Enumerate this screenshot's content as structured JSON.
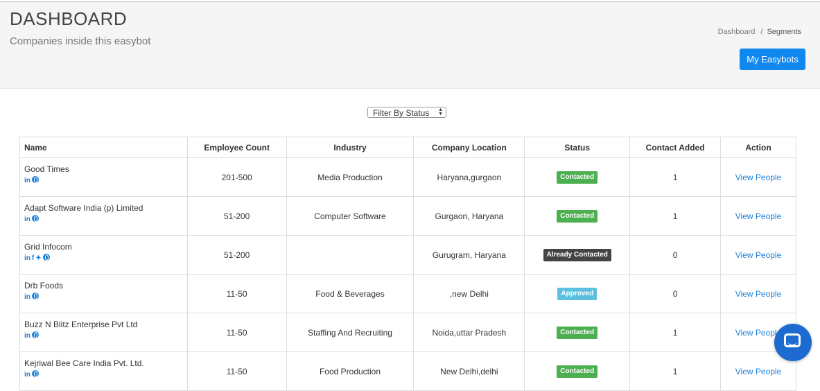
{
  "header": {
    "title": "DASHBOARD",
    "subtitle": "Companies inside this easybot",
    "breadcrumb": {
      "home": "Dashboard",
      "separator": "/",
      "current": "Segments"
    },
    "primary_button": "My Easybots"
  },
  "filter": {
    "selected": "Filter By Status"
  },
  "table": {
    "columns": [
      "Name",
      "Employee Count",
      "Industry",
      "Company Location",
      "Status",
      "Contact Added",
      "Action"
    ],
    "rows": [
      {
        "name": "Good Times",
        "employees": "201-500",
        "industry": "Media Production",
        "location": "Haryana,gurgaon",
        "status": "Contacted",
        "contacts": "1",
        "action": "View People"
      },
      {
        "name": "Adapt Software India (p) Limited",
        "employees": "51-200",
        "industry": "Computer Software",
        "location": "Gurgaon, Haryana",
        "status": "Contacted",
        "contacts": "1",
        "action": "View People"
      },
      {
        "name": "Grid Infocom",
        "employees": "51-200",
        "industry": "",
        "location": "Gurugram, Haryana",
        "status": "Already Contacted",
        "contacts": "0",
        "action": "View People"
      },
      {
        "name": "Drb Foods",
        "employees": "11-50",
        "industry": "Food & Beverages",
        "location": ",new Delhi",
        "status": "Approved",
        "contacts": "0",
        "action": "View People"
      },
      {
        "name": "Buzz N Blitz Enterprise Pvt Ltd",
        "employees": "11-50",
        "industry": "Staffing And Recruiting",
        "location": "Noida,uttar Pradesh",
        "status": "Contacted",
        "contacts": "1",
        "action": "View People"
      },
      {
        "name": "Kejriwal Bee Care India Pvt. Ltd.",
        "employees": "11-50",
        "industry": "Food Production",
        "location": "New Delhi,delhi",
        "status": "Contacted",
        "contacts": "1",
        "action": "View People"
      }
    ]
  },
  "social_glyphs": {
    "linkedin": "in",
    "facebook": "f",
    "twitter": "✦"
  },
  "icons": {
    "social": [
      "linkedin-icon",
      "facebook-icon",
      "twitter-icon",
      "globe-icon"
    ],
    "chat": "chat-icon"
  },
  "colors": {
    "primary": "#1088f0",
    "link": "#1a7ed6",
    "status_contacted": "#4caf50",
    "status_already_contacted": "#444444",
    "status_approved": "#5bc0de",
    "chat": "#1d6bd1"
  }
}
